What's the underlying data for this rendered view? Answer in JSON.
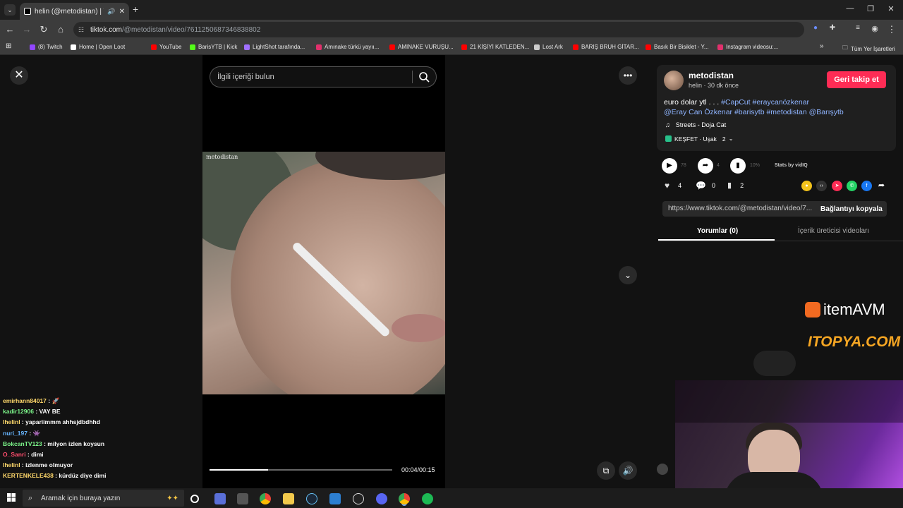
{
  "browser": {
    "tab_title": "helin (@metodistan) | TikTo",
    "url_domain": "tiktok.com",
    "url_path": "/@metodistan/video/7611250687346838802",
    "bookmarks": [
      {
        "label": "(8) Twitch",
        "color": "#9146ff"
      },
      {
        "label": "Home | Open Loot",
        "color": "#ffffff"
      },
      {
        "label": "YouTube",
        "color": "#ff0000"
      },
      {
        "label": "BarisYTB | Kick",
        "color": "#53fc18"
      },
      {
        "label": "LightShot tarafında...",
        "color": "#a070ff"
      },
      {
        "label": "Amınake türkü yayıı...",
        "color": "#e1306c"
      },
      {
        "label": "AMINAKE VURUŞU...",
        "color": "#ff0000"
      },
      {
        "label": "21 KİŞİYİ KATLEDEN...",
        "color": "#ff0000"
      },
      {
        "label": "Lost Ark",
        "color": "#cccccc"
      },
      {
        "label": "BARIŞ BRUH GİTAR...",
        "color": "#ff0000"
      },
      {
        "label": "Basık Bir Bisiklet - Y...",
        "color": "#ff0000"
      },
      {
        "label": "Instagram videosu:...",
        "color": "#e1306c"
      }
    ],
    "all_bookmarks": "Tüm Yer İşaretleri"
  },
  "player": {
    "search_placeholder": "İlgili içeriği bulun",
    "watermark": "metodistan",
    "time": "00:04/00:15",
    "progress": 0.32
  },
  "author": {
    "name": "metodistan",
    "sub": "helin · 30 dk önce",
    "follow_label": "Geri takip et"
  },
  "caption": {
    "plain": "euro dolar ytl . . . ",
    "tags_line1": "#CapCut #eraycanözkenar",
    "tags_line2": "@Eray Can Özkenar #barisytb #metodistan @Barışytb"
  },
  "music": {
    "icon": "♫",
    "title": "Streets - Doja Cat"
  },
  "location": {
    "label": "KEŞFET · Uşak",
    "count": "2"
  },
  "stats": {
    "plays": "78",
    "shares_small": "4",
    "percent": "10%",
    "stats_by": "Stats by vidIQ",
    "likes": "4",
    "comments": "0",
    "saves": "2"
  },
  "link": {
    "url": "https://www.tiktok.com/@metodistan/video/7...",
    "copy_label": "Bağlantıyı kopyala"
  },
  "tabs": {
    "comments": "Yorumlar (0)",
    "creator_videos": "İçerik üreticisi videoları"
  },
  "overlays": {
    "itemavm": "itemAVM",
    "itopya": "ITOPYA.COM"
  },
  "chat": [
    {
      "user": "emirhann84017",
      "msg": " : 🚀",
      "color": "#ffd86b"
    },
    {
      "user": "kadir12906",
      "msg": " : VAY BE",
      "color": "#7cf58a"
    },
    {
      "user": "lhelinl",
      "msg": " : yapariimmm ahhsjdbdhhd",
      "color": "#ffd86b"
    },
    {
      "user": "nuri_197",
      "msg": " : 👾",
      "color": "#67b5ff"
    },
    {
      "user": "BokcanTV123",
      "msg": " : milyon izlen koysun",
      "color": "#7cf58a"
    },
    {
      "user": "O_Sanri",
      "msg": " : dimi",
      "color": "#ff4d6d"
    },
    {
      "user": "lhelinl",
      "msg": " : izlenme olmuyor",
      "color": "#ffd86b"
    },
    {
      "user": "KERTENKELE438",
      "msg": " : kürdüz diye dimi",
      "color": "#ffd86b"
    }
  ],
  "taskbar": {
    "search_placeholder": "Aramak için buraya yazın"
  }
}
